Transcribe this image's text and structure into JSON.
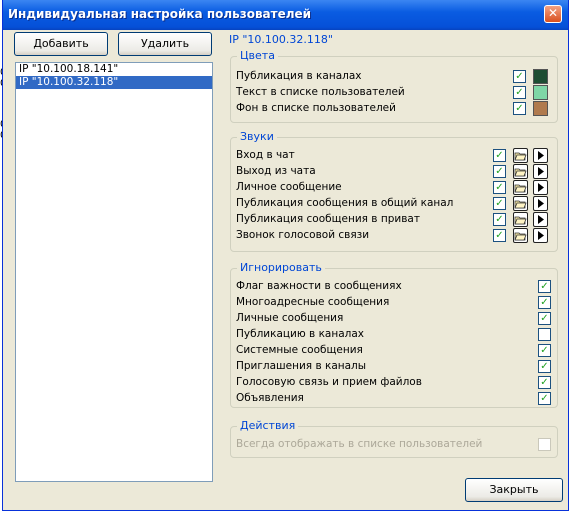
{
  "background": {
    "fragments": [
      "0",
      "0",
      "0",
      "0"
    ]
  },
  "window": {
    "title": "Индивидуальная настройка пользователей",
    "close_glyph": "✕"
  },
  "toolbar": {
    "add_label": "Добавить",
    "delete_label": "Удалить"
  },
  "users": [
    {
      "label": "IP \"10.100.18.141\"",
      "selected": false
    },
    {
      "label": "IP \"10.100.32.118\"",
      "selected": true
    }
  ],
  "panel": {
    "header": "IP \"10.100.32.118\"",
    "colors": {
      "title": "Цвета",
      "items": [
        {
          "label": "Публикация в каналах",
          "checked": true,
          "color": "#1d4d32"
        },
        {
          "label": "Текст в списке пользователей",
          "checked": true,
          "color": "#7fd6a6"
        },
        {
          "label": "Фон в списке пользователей",
          "checked": true,
          "color": "#b07a4d"
        }
      ]
    },
    "sounds": {
      "title": "Звуки",
      "items": [
        {
          "label": "Вход в чат",
          "checked": true
        },
        {
          "label": "Выход из чата",
          "checked": true
        },
        {
          "label": "Личное сообщение",
          "checked": true
        },
        {
          "label": "Публикация сообщения в общий канал",
          "checked": true
        },
        {
          "label": "Публикация сообщения в приват",
          "checked": true
        },
        {
          "label": "Звонок голосовой связи",
          "checked": true
        }
      ]
    },
    "ignore": {
      "title": "Игнорировать",
      "items": [
        {
          "label": "Флаг важности в сообщениях",
          "checked": true
        },
        {
          "label": "Многоадресные сообщения",
          "checked": true
        },
        {
          "label": "Личные сообщения",
          "checked": true
        },
        {
          "label": "Публикацию в каналах",
          "checked": false
        },
        {
          "label": "Системные сообщения",
          "checked": true
        },
        {
          "label": "Приглашения в каналы",
          "checked": true
        },
        {
          "label": "Голосовую связь и прием файлов",
          "checked": true
        },
        {
          "label": "Объявления",
          "checked": true
        }
      ]
    },
    "actions": {
      "title": "Действия",
      "items": [
        {
          "label": "Всегда отображать в списке пользователей",
          "checked": false,
          "disabled": true
        }
      ]
    }
  },
  "footer": {
    "close_label": "Закрыть"
  },
  "icons": {
    "check": "✓",
    "folder": "folder-open-icon",
    "play": "play-icon"
  }
}
